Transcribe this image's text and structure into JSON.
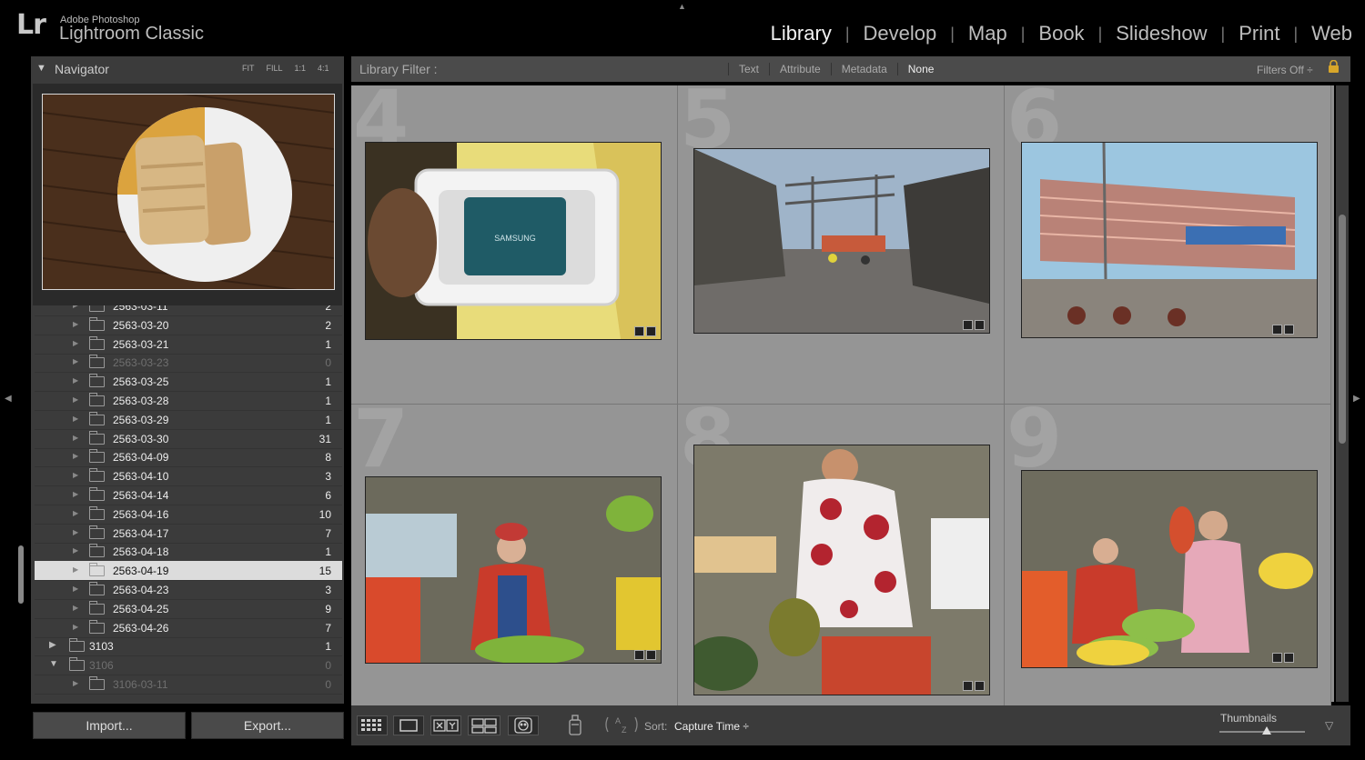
{
  "app": {
    "brand_small": "Adobe Photoshop",
    "brand_large": "Lightroom Classic",
    "logo": "Lr"
  },
  "modules": [
    {
      "label": "Library",
      "active": true
    },
    {
      "label": "Develop",
      "active": false
    },
    {
      "label": "Map",
      "active": false
    },
    {
      "label": "Book",
      "active": false
    },
    {
      "label": "Slideshow",
      "active": false
    },
    {
      "label": "Print",
      "active": false
    },
    {
      "label": "Web",
      "active": false
    }
  ],
  "navigator": {
    "title": "Navigator",
    "zoom_options": [
      "FIT",
      "FILL",
      "1:1",
      "4:1"
    ]
  },
  "folders": [
    {
      "name": "2563-03-11",
      "count": "2",
      "dim": false
    },
    {
      "name": "2563-03-20",
      "count": "2",
      "dim": false
    },
    {
      "name": "2563-03-21",
      "count": "1",
      "dim": false
    },
    {
      "name": "2563-03-23",
      "count": "0",
      "dim": true
    },
    {
      "name": "2563-03-25",
      "count": "1",
      "dim": false
    },
    {
      "name": "2563-03-28",
      "count": "1",
      "dim": false
    },
    {
      "name": "2563-03-29",
      "count": "1",
      "dim": false
    },
    {
      "name": "2563-03-30",
      "count": "31",
      "dim": false
    },
    {
      "name": "2563-04-09",
      "count": "8",
      "dim": false
    },
    {
      "name": "2563-04-10",
      "count": "3",
      "dim": false
    },
    {
      "name": "2563-04-14",
      "count": "6",
      "dim": false
    },
    {
      "name": "2563-04-16",
      "count": "10",
      "dim": false
    },
    {
      "name": "2563-04-17",
      "count": "7",
      "dim": false
    },
    {
      "name": "2563-04-18",
      "count": "1",
      "dim": false
    },
    {
      "name": "2563-04-19",
      "count": "15",
      "dim": false,
      "selected": true
    },
    {
      "name": "2563-04-23",
      "count": "3",
      "dim": false
    },
    {
      "name": "2563-04-25",
      "count": "9",
      "dim": false
    },
    {
      "name": "2563-04-26",
      "count": "7",
      "dim": false
    },
    {
      "name": "3103",
      "count": "1",
      "dim": false,
      "top": true,
      "tri": "▶"
    },
    {
      "name": "3106",
      "count": "0",
      "dim": true,
      "top": true,
      "tri": "▼"
    },
    {
      "name": "3106-03-11",
      "count": "0",
      "dim": true
    }
  ],
  "buttons": {
    "import": "Import...",
    "export": "Export..."
  },
  "filter": {
    "label": "Library Filter :",
    "options": [
      {
        "label": "Text",
        "on": false
      },
      {
        "label": "Attribute",
        "on": false
      },
      {
        "label": "Metadata",
        "on": false
      },
      {
        "label": "None",
        "on": true
      }
    ],
    "filters_off": "Filters Off ÷"
  },
  "grid": {
    "cells": [
      {
        "number": "4",
        "subject": "ssd-in-hand"
      },
      {
        "number": "5",
        "subject": "street-market"
      },
      {
        "number": "6",
        "subject": "market-building"
      },
      {
        "number": "7",
        "subject": "banana-vendor"
      },
      {
        "number": "8",
        "subject": "durian-seller"
      },
      {
        "number": "9",
        "subject": "fruit-stall"
      }
    ],
    "ssd_brand": "SAMSUNG"
  },
  "toolbar": {
    "sort_label": "Sort:",
    "sort_value": "Capture Time ÷",
    "thumbnails_label": "Thumbnails",
    "thumbnail_size": 0.55
  },
  "colors": {
    "accent_active": "#f2f2f2",
    "panel": "#3b3b3b",
    "grid_bg": "#959595",
    "selected_row": "#dcdcdc"
  }
}
